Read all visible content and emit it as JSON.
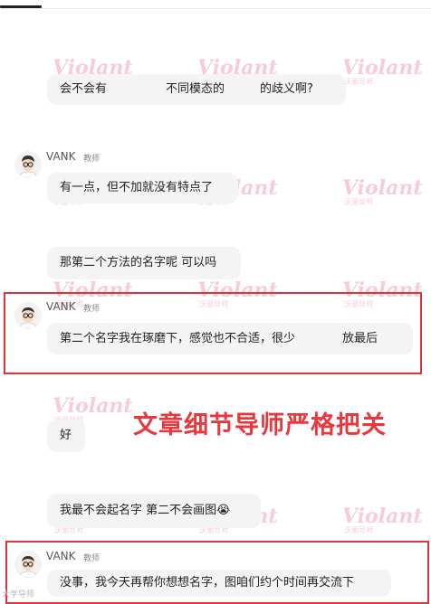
{
  "messages": {
    "m1": "会不会有　　　　　不同模态的　　　的歧义啊?",
    "m2_sender": "VANK",
    "m2_role": "教师",
    "m2_text": "有一点，但不加就没有特点了",
    "m3": "那第二个方法的名字呢 可以吗",
    "m4_sender": "VANK",
    "m4_role": "教师",
    "m4_text": "第二个名字我在琢磨下，感觉也不合适，很少　　　　放最后",
    "m5": "好",
    "m6": "我最不会起名字 第二不会画图😭",
    "m7_sender": "VANK",
    "m7_role": "教师",
    "m7_text": "没事，我今天再帮你想想名字，图咱们约个时间再交流下"
  },
  "overlay_text": "文章细节导师严格把关",
  "watermark": {
    "brand": "Violant",
    "sub": "沃丽导师"
  },
  "corner_text": "大学导师",
  "colors": {
    "highlight_border": "#d9363e",
    "overlay_red": "#e8383d",
    "bubble_bg": "#f4f4f4",
    "watermark": "#f2a3b8"
  }
}
